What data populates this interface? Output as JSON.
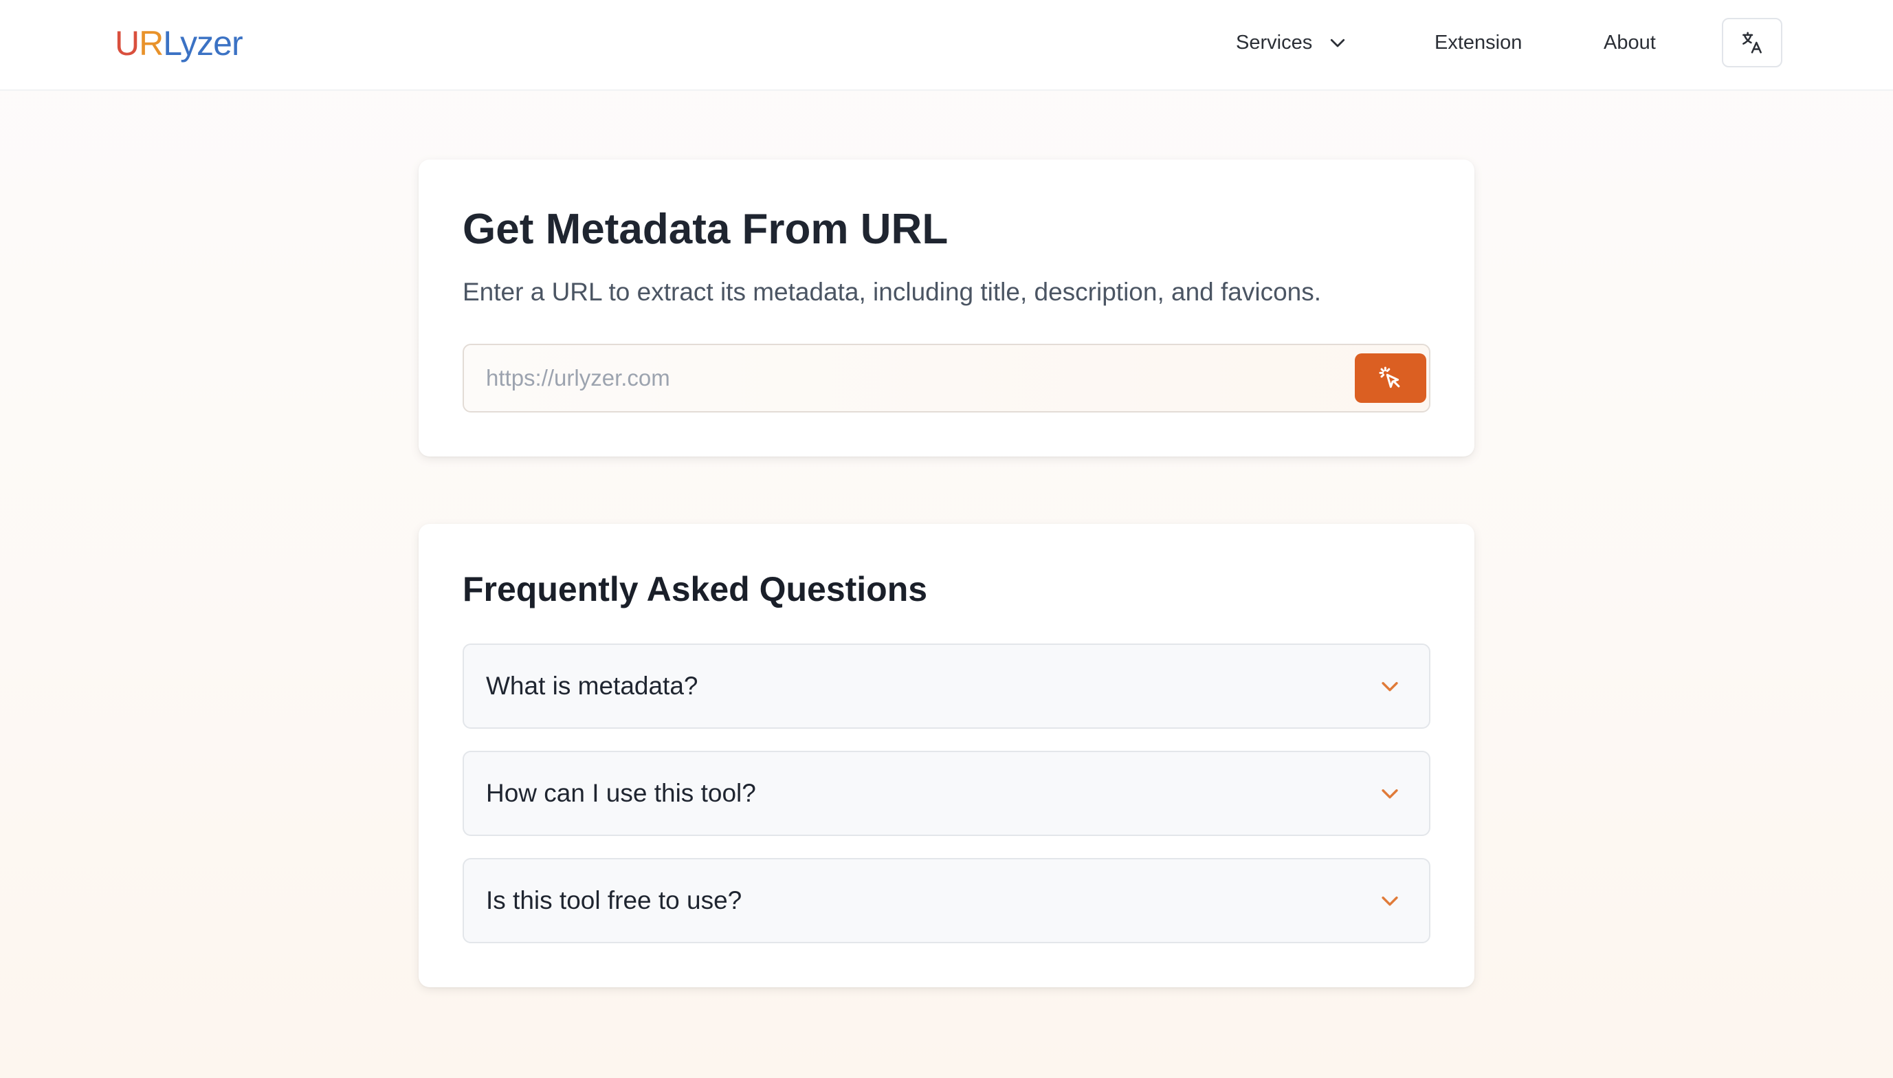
{
  "brand": {
    "logo_part1": "U",
    "logo_part2": "R",
    "logo_part3": "Lyzer",
    "colors": {
      "u": "#d94f3d",
      "r": "#e8922a",
      "lyzer": "#3b72c4"
    }
  },
  "nav": {
    "services_label": "Services",
    "services_icon": "chevron-down-icon",
    "extension_label": "Extension",
    "about_label": "About",
    "language_icon": "translate-icon"
  },
  "hero": {
    "title": "Get Metadata From URL",
    "subtitle": "Enter a URL to extract its metadata, including title, description, and favicons.",
    "input_value": "",
    "input_placeholder": "https://urlyzer.com",
    "submit_icon": "pointer-click-icon",
    "accent_color": "#db5f22"
  },
  "faq": {
    "title": "Frequently Asked Questions",
    "items": [
      {
        "question": "What is metadata?"
      },
      {
        "question": "How can I use this tool?"
      },
      {
        "question": "Is this tool free to use?"
      }
    ],
    "chevron_color": "#e07b39"
  }
}
